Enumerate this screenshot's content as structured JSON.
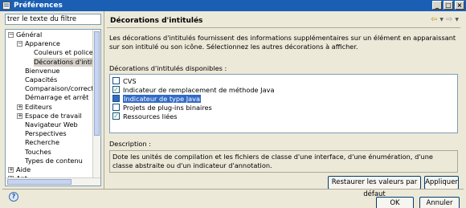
{
  "window": {
    "title": "Préférences"
  },
  "filter": {
    "value": "trer le texte du filtre"
  },
  "tree": {
    "items": [
      {
        "label": "Général",
        "toggle": "−"
      },
      {
        "label": "Apparence",
        "toggle": "−"
      },
      {
        "label": "Couleurs et polices",
        "toggle": ""
      },
      {
        "label": "Décorations d'intitulé",
        "toggle": ""
      },
      {
        "label": "Bienvenue",
        "toggle": ""
      },
      {
        "label": "Capacités",
        "toggle": ""
      },
      {
        "label": "Comparaison/correctif",
        "toggle": ""
      },
      {
        "label": "Démarrage et arrêt",
        "toggle": ""
      },
      {
        "label": "Editeurs",
        "toggle": "+"
      },
      {
        "label": "Espace de travail",
        "toggle": "+"
      },
      {
        "label": "Navigateur Web",
        "toggle": ""
      },
      {
        "label": "Perspectives",
        "toggle": ""
      },
      {
        "label": "Recherche",
        "toggle": ""
      },
      {
        "label": "Touches",
        "toggle": ""
      },
      {
        "label": "Types de contenu",
        "toggle": ""
      },
      {
        "label": "Aide",
        "toggle": "+"
      },
      {
        "label": "Ant",
        "toggle": "+"
      }
    ]
  },
  "page": {
    "title": "Décorations d'intitulés",
    "description": "Les décorations d'intitulés fournissent des informations supplémentaires sur un élément en apparaissant sur son intitulé ou son icône. Sélectionnez les autres décorations à afficher.",
    "list_label": "Décorations d'intitulés disponibles :",
    "decorations": [
      {
        "label": "CVS",
        "check": ""
      },
      {
        "label": "Indicateur de remplacement de méthode Java",
        "check": "✓"
      },
      {
        "label": "Indicateur de type Java",
        "check": ""
      },
      {
        "label": "Projets de plug-ins binaires",
        "check": ""
      },
      {
        "label": "Ressources liées",
        "check": "✓"
      }
    ],
    "desc_label": "Description :",
    "desc_text": "Dote les unités de compilation et les fichiers de classe d'une interface, d'une énumération, d'une classe abstraite ou d'un indicateur d'annotation."
  },
  "buttons": {
    "restore": "Restaurer les valeurs par défaut",
    "apply": "Appliquer",
    "ok": "OK",
    "cancel": "Annuler"
  },
  "icons": {
    "app": "preferences-icon",
    "back": "back-arrow-icon",
    "forward": "forward-arrow-icon",
    "help": "help-icon"
  },
  "colors": {
    "titlebar": "#1a5fb4",
    "selection": "#316ac5",
    "check": "#21a121"
  }
}
